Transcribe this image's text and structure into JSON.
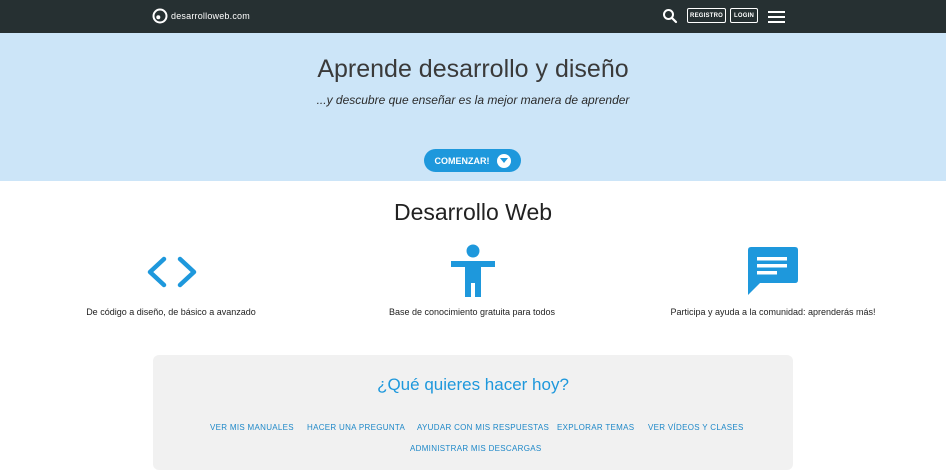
{
  "header": {
    "logo_text": "desarrolloweb.com",
    "register_label": "REGISTRO",
    "login_label": "LOGIN"
  },
  "hero": {
    "title": "Aprende desarrollo y diseño",
    "subtitle": "...y descubre que enseñar es la mejor manera de aprender",
    "start_label": "COMENZAR!"
  },
  "section": {
    "title": "Desarrollo Web",
    "features": [
      {
        "icon": "code-icon",
        "text": "De código a diseño, de básico a avanzado"
      },
      {
        "icon": "person-icon",
        "text": "Base de conocimiento gratuita para todos"
      },
      {
        "icon": "chat-icon",
        "text": "Participa y ayuda a la comunidad: aprenderás más!"
      }
    ]
  },
  "panel": {
    "title": "¿Qué quieres hacer hoy?",
    "actions": [
      "VER MIS MANUALES",
      "HACER UNA PREGUNTA",
      "AYUDAR CON MIS RESPUESTAS",
      "EXPLORAR TEMAS",
      "VER VÍDEOS Y CLASES",
      "ADMINISTRAR MIS DESCARGAS"
    ]
  },
  "colors": {
    "topbar": "#263032",
    "hero_bg": "#cce5f8",
    "accent": "#1e98dc"
  }
}
